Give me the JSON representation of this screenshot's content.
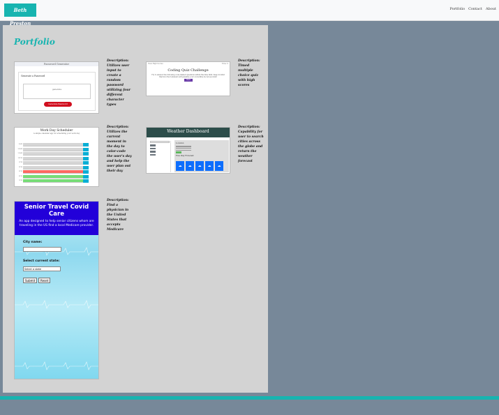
{
  "navbar": {
    "brand": "Beth Preston",
    "links": [
      "Portfolio",
      "Contact",
      "About"
    ]
  },
  "portfolio": {
    "title": "Portfolio",
    "projects": [
      {
        "id": "password-generator",
        "description": "Description: Utilizes user input to create a random password utilizing four different character types",
        "screenshot": {
          "header": "Password Generator",
          "card_title": "Generate a Password",
          "placeholder": "generate",
          "button": "Generate Password"
        }
      },
      {
        "id": "coding-quiz",
        "description": "Description: Timed multiple choice quiz with high scores",
        "screenshot": {
          "top_left": "View High Scores",
          "top_right": "Time: 0",
          "title": "Coding Quiz Challenge",
          "body": "Try to answer the following code-related questions within the time limit. Keep in mind that incorrect answers will penalize your score/time by ten seconds!",
          "button": "Start"
        }
      },
      {
        "id": "work-day-scheduler",
        "description": "Description: Utilizes the current moment in the day to color-code the user's day and help the user plan out their day",
        "screenshot": {
          "title": "Work Day Scheduler",
          "subtitle": "A simple calendar app for scheduling your work day",
          "hours": [
            "9AM",
            "10AM",
            "11AM",
            "12PM",
            "1PM",
            "2PM",
            "3PM",
            "4PM",
            "5PM"
          ],
          "row_states": [
            "past",
            "past",
            "past",
            "past",
            "past",
            "past",
            "present",
            "future",
            "future"
          ]
        }
      },
      {
        "id": "weather-dashboard",
        "description": "Description: Capability for user to search cities across the globe and return the weather forecast",
        "screenshot": {
          "header": "Weather Dashboard",
          "city": "London",
          "forecast_title": "Five Day Forecast",
          "forecast_days": 5
        }
      },
      {
        "id": "senior-travel-covid-care",
        "description": "Description: Find a physician in the United States that accepts Medicare",
        "screenshot": {
          "title": "Senior Travel Covid Care",
          "subtitle": "An app designed to help senior citizens whom are traveling in the US find a local Medicare provider.",
          "city_label": "City name:",
          "state_label": "Select current state:",
          "state_select": "Select a state",
          "submit": "Submit",
          "reset": "Reset"
        }
      }
    ]
  },
  "colors": {
    "accent": "#17b4b0",
    "background": "#778899",
    "panel": "#d3d3d3",
    "navbar": "#f8f9fa"
  }
}
